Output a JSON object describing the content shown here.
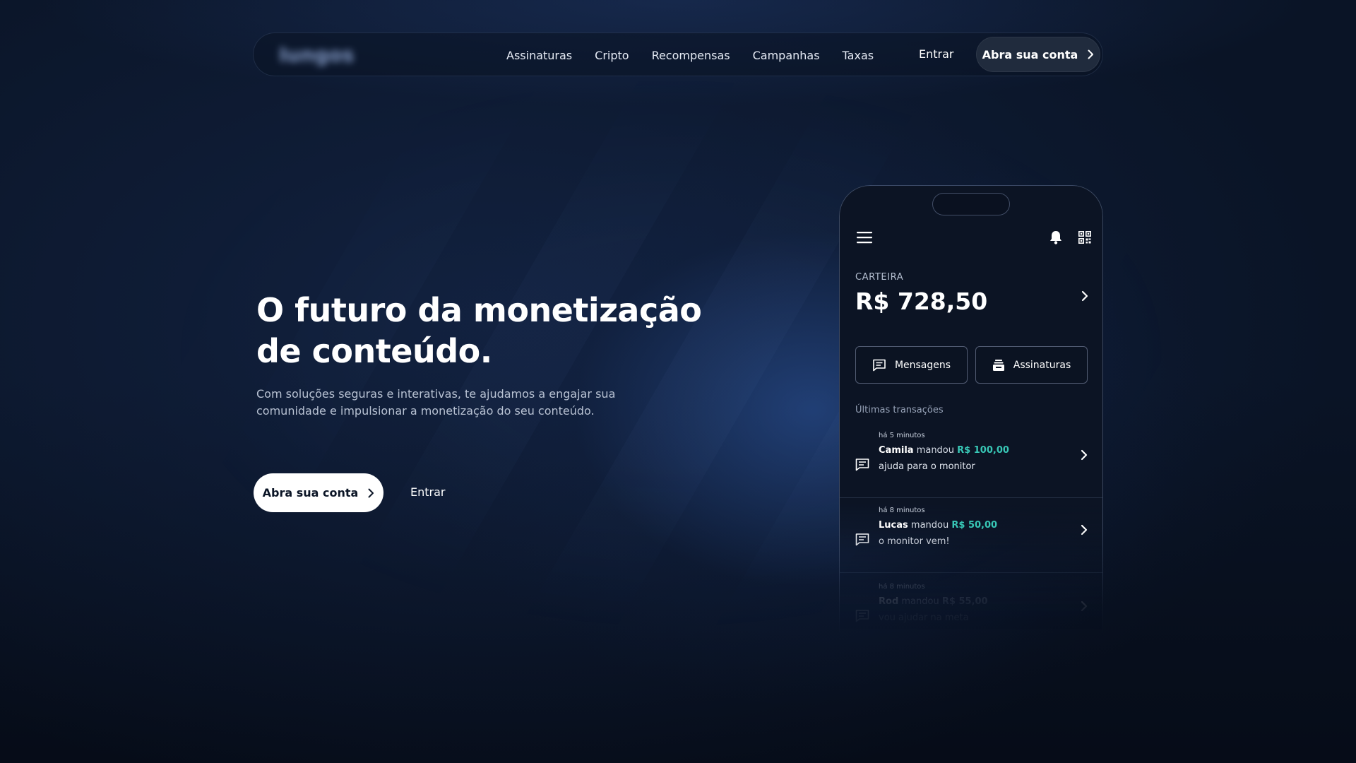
{
  "nav": {
    "logo": "Iungos",
    "links": [
      "Assinaturas",
      "Cripto",
      "Recompensas",
      "Campanhas",
      "Taxas"
    ],
    "login": "Entrar",
    "cta": "Abra sua conta"
  },
  "hero": {
    "title": "O futuro da monetização de conteúdo.",
    "subtitle": "Com soluções seguras e interativas, te ajudamos a engajar sua comunidade e impulsionar a monetização do seu conteúdo.",
    "cta": "Abra sua conta",
    "login": "Entrar"
  },
  "phone": {
    "wallet_label": "CARTEIRA",
    "balance": "R$ 728,50",
    "buttons": [
      "Mensagens",
      "Assinaturas"
    ],
    "section_title": "Últimas transações",
    "transactions": [
      {
        "time": "há 5 minutos",
        "name": "Camila",
        "verb": "mandou",
        "amount": "R$ 100,00",
        "message": "ajuda para o monitor"
      },
      {
        "time": "há 8 minutos",
        "name": "Lucas",
        "verb": "mandou",
        "amount": "R$ 50,00",
        "message": "o monitor vem!"
      },
      {
        "time": "há 8 minutos",
        "name": "Rod",
        "verb": "mandou",
        "amount": "R$ 55,00",
        "message": "vou ajudar na meta"
      }
    ]
  },
  "colors": {
    "background": "#0a1426",
    "accent_amount": "#38c7b6",
    "cta_dark": "#202b3d",
    "cta_light": "#ffffff"
  }
}
